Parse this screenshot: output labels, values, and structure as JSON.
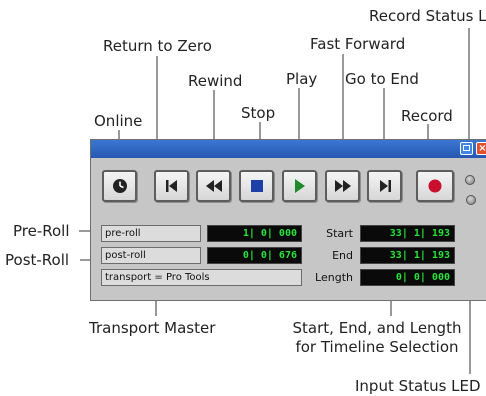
{
  "callouts": {
    "record_status_led": "Record Status LED",
    "return_to_zero": "Return to Zero",
    "fast_forward": "Fast Forward",
    "rewind": "Rewind",
    "play": "Play",
    "go_to_end": "Go to End",
    "stop": "Stop",
    "online": "Online",
    "record": "Record",
    "pre_roll": "Pre-Roll",
    "post_roll": "Post-Roll",
    "transport_master": "Transport Master",
    "selection_line1": "Start, End, and Length",
    "selection_line2": "for Timeline Selection",
    "input_status_led": "Input Status LED"
  },
  "window": {
    "titlebar_close_glyph": "×",
    "buttons": [
      "online",
      "return-to-zero",
      "rewind",
      "stop",
      "play",
      "fast-forward",
      "go-to-end",
      "record"
    ],
    "pre_roll_label": "pre-roll",
    "pre_roll_value": "1| 0| 000",
    "post_roll_label": "post-roll",
    "post_roll_value": "0| 0| 676",
    "transport_label": "transport = Pro Tools",
    "start_label": "Start",
    "start_value": "33| 1| 193",
    "end_label": "End",
    "end_value": "33| 1| 193",
    "length_label": "Length",
    "length_value": "0| 0| 000"
  },
  "colors": {
    "titlebar": "#2f66c4",
    "counter_text": "#27e43a",
    "record": "#c8102e",
    "play": "#1f8a2a",
    "stop": "#1f3fa8"
  }
}
